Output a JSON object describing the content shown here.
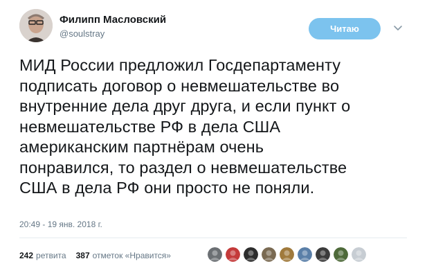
{
  "author": {
    "display_name": "Филипп Масловский",
    "handle": "@soulstray",
    "avatar_icon": "user-avatar"
  },
  "follow_button": {
    "label": "Читаю"
  },
  "menu_icon": "chevron-down-icon",
  "tweet": {
    "text": "МИД России предложил Госдепартаменту\nподписать договор о невмешательстве во\nвнутренние дела друг друга, и если пункт о\nневмешательстве РФ в дела США\nамериканским партнёрам очень\nпонравился, то раздел о невмешательстве\nСША в дела РФ они просто не поняли.",
    "timestamp": "20:49 - 19 янв. 2018 г."
  },
  "stats": {
    "retweets_count": "242",
    "retweets_label": "ретвита",
    "likes_count": "387",
    "likes_label": "отметок «Нравится»"
  },
  "likers": [
    {
      "name": "liker-avatar-1",
      "color": "#6b6f73"
    },
    {
      "name": "liker-avatar-2",
      "color": "#c43a3a"
    },
    {
      "name": "liker-avatar-3",
      "color": "#2d2d2d"
    },
    {
      "name": "liker-avatar-4",
      "color": "#7a6a52"
    },
    {
      "name": "liker-avatar-5",
      "color": "#a07a3c"
    },
    {
      "name": "liker-avatar-6",
      "color": "#5a7fa8"
    },
    {
      "name": "liker-avatar-7",
      "color": "#3b3b3b"
    },
    {
      "name": "liker-avatar-8",
      "color": "#4e6a3a"
    },
    {
      "name": "liker-avatar-9",
      "color": "#c7cdd3"
    }
  ],
  "colors": {
    "accent": "#7cc3ee",
    "secondary_text": "#657786",
    "primary_text": "#14171a"
  }
}
